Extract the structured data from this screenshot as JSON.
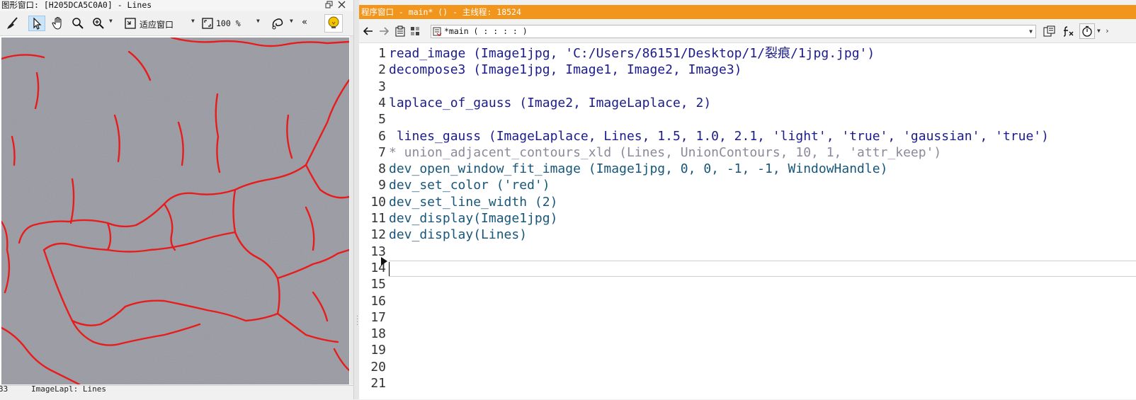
{
  "graphics_window": {
    "title": "图形窗口: [H205DCA5C0A0] - Lines",
    "zoom_mode_label": "适应窗口",
    "zoom_percent_label": "100 %",
    "more_label": "«",
    "bottom_status_left": "33",
    "bottom_status_right": "ImageLapl: Lines",
    "line_color": "#e81c1c"
  },
  "program_window": {
    "title": "程序窗口 - main* () - 主线程: 18524",
    "title_bg": "#f2951d",
    "procedure_value": "*main ( : : : : )",
    "lines": [
      {
        "n": "1",
        "text": "read_image (Image1jpg, 'C:/Users/86151/Desktop/1/裂痕/1jpg.jpg')",
        "kind": "op"
      },
      {
        "n": "2",
        "text": "decompose3 (Image1jpg, Image1, Image2, Image3)",
        "kind": "op"
      },
      {
        "n": "3",
        "text": "",
        "kind": "op"
      },
      {
        "n": "4",
        "text": "laplace_of_gauss (Image2, ImageLaplace, 2)",
        "kind": "op"
      },
      {
        "n": "5",
        "text": "",
        "kind": "op"
      },
      {
        "n": "6",
        "text": " lines_gauss (ImageLaplace, Lines, 1.5, 1.0, 2.1, 'light', 'true', 'gaussian', 'true')",
        "kind": "op"
      },
      {
        "n": "7",
        "text": "* union_adjacent_contours_xld (Lines, UnionContours, 10, 1, 'attr_keep')",
        "kind": "cm"
      },
      {
        "n": "8",
        "text": "dev_open_window_fit_image (Image1jpg, 0, 0, -1, -1, WindowHandle)",
        "kind": "dev"
      },
      {
        "n": "9",
        "text": "dev_set_color ('red')",
        "kind": "dev"
      },
      {
        "n": "10",
        "text": "dev_set_line_width (2)",
        "kind": "dev"
      },
      {
        "n": "11",
        "text": "dev_display(Image1jpg)",
        "kind": "dev"
      },
      {
        "n": "12",
        "text": "dev_display(Lines)",
        "kind": "dev"
      },
      {
        "n": "13",
        "text": "",
        "kind": "op"
      },
      {
        "n": "14",
        "text": "",
        "kind": "op"
      },
      {
        "n": "15",
        "text": "",
        "kind": "op"
      },
      {
        "n": "16",
        "text": "",
        "kind": "op"
      },
      {
        "n": "17",
        "text": "",
        "kind": "op"
      },
      {
        "n": "18",
        "text": "",
        "kind": "op"
      },
      {
        "n": "19",
        "text": "",
        "kind": "op"
      },
      {
        "n": "20",
        "text": "",
        "kind": "op"
      },
      {
        "n": "21",
        "text": "",
        "kind": "op"
      }
    ]
  }
}
